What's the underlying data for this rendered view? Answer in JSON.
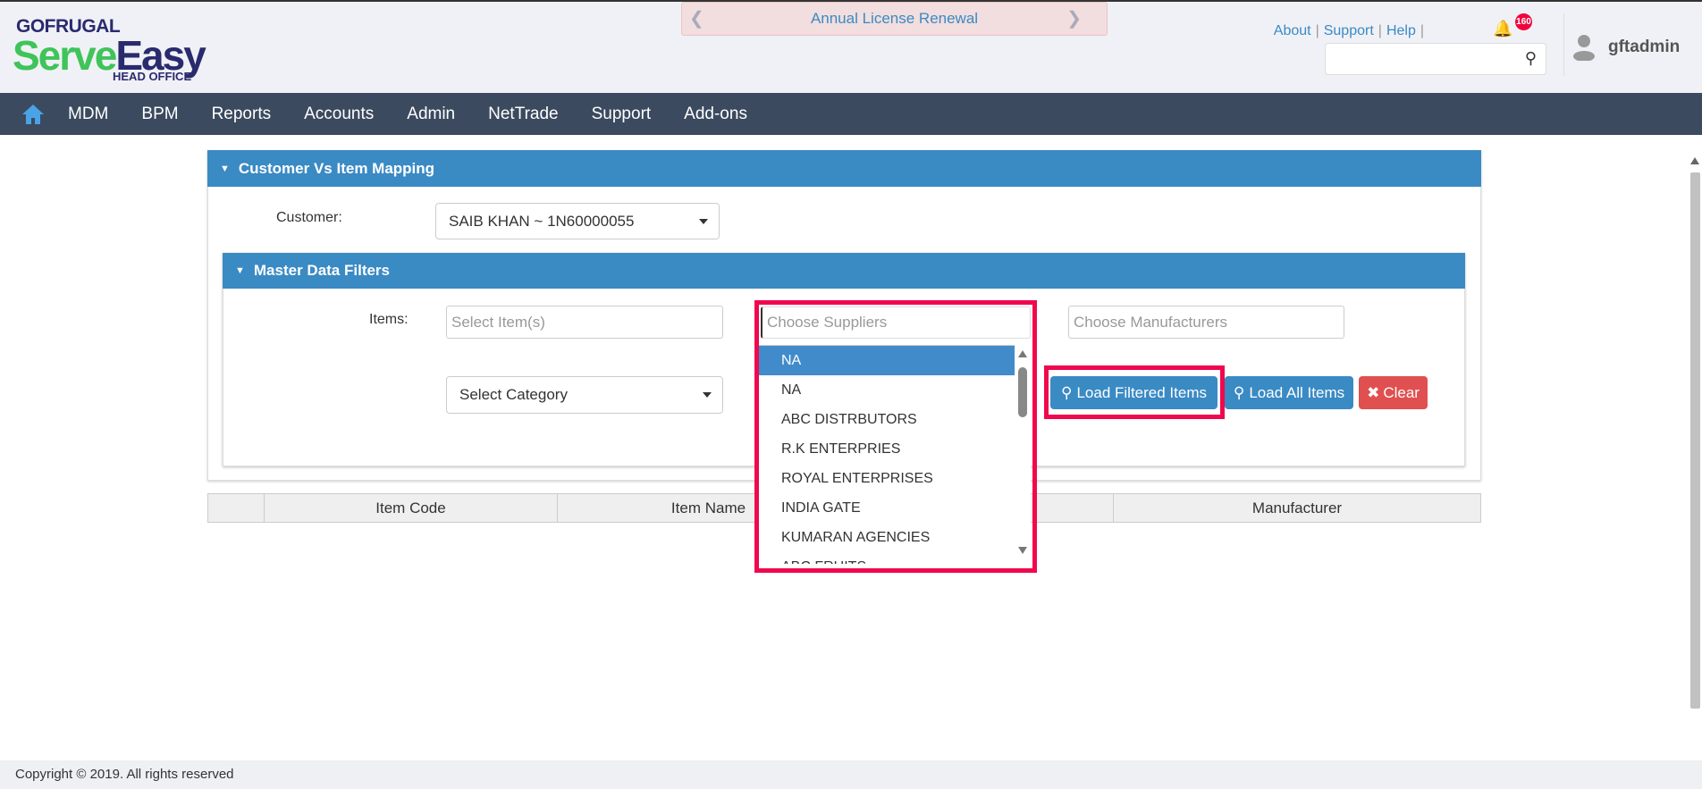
{
  "logo": {
    "brand": "GOFRUGAL",
    "product_a": "Serve",
    "product_b": "Easy",
    "edition": "HEAD OFFICE"
  },
  "banner": {
    "text": "Annual License Renewal"
  },
  "toplinks": {
    "about": "About",
    "support": "Support",
    "help": "Help",
    "notif_count": "160"
  },
  "user": {
    "name": "gftadmin"
  },
  "nav": [
    "MDM",
    "BPM",
    "Reports",
    "Accounts",
    "Admin",
    "NetTrade",
    "Support",
    "Add-ons"
  ],
  "panel": {
    "title": "Customer Vs Item Mapping",
    "customer_label": "Customer:",
    "customer_value": "SAIB KHAN ~ 1N60000055"
  },
  "filters": {
    "title": "Master Data Filters",
    "items_label": "Items:",
    "items_placeholder": "Select Item(s)",
    "suppliers_placeholder": "Choose Suppliers",
    "manufacturers_placeholder": "Choose Manufacturers",
    "category_value": "Select Category"
  },
  "buttons": {
    "load_filtered": "Load Filtered Items",
    "load_all": "Load All Items",
    "clear": "Clear"
  },
  "supplier_options": [
    "NA",
    "NA",
    "ABC DISTRBUTORS",
    "R.K ENTERPRIES",
    "ROYAL ENTERPRISES",
    "INDIA GATE",
    "KUMARAN AGENCIES",
    "ABC FRUITS"
  ],
  "table": {
    "headers": [
      "",
      "Item Code",
      "Item Name",
      "",
      "Manufacturer"
    ]
  },
  "footer": {
    "text": "Copyright © 2019. All rights reserved"
  },
  "colors": {
    "accent": "#3a8ac4",
    "nav": "#3b4a5f",
    "danger": "#e05050",
    "highlight": "#f0084e"
  }
}
